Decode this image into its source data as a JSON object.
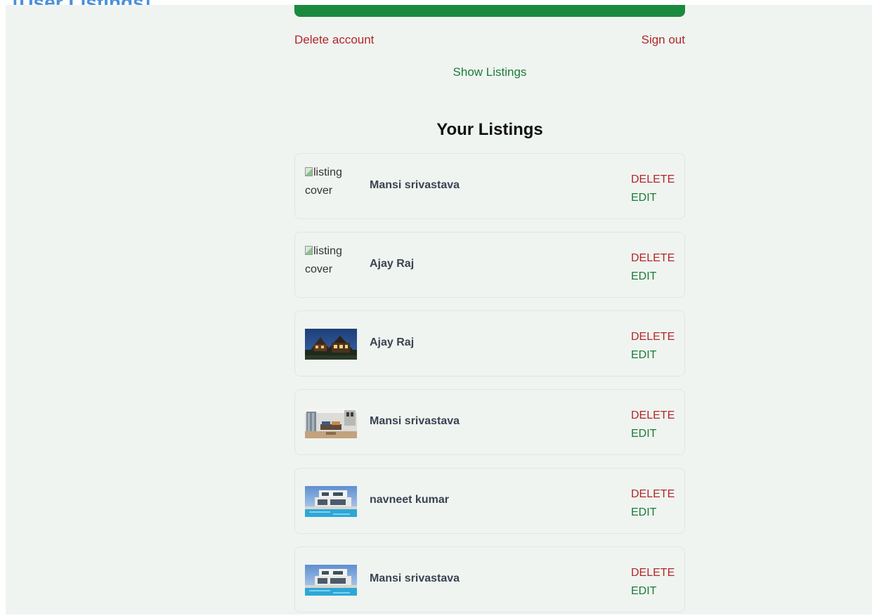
{
  "page_caption": "[User Listings]",
  "account": {
    "delete_account": "Delete account",
    "sign_out": "Sign out",
    "primary_color": "#1a8a3e",
    "danger_color": "#b3262a"
  },
  "show_listings": "Show Listings",
  "listings_title": "Your Listings",
  "actions": {
    "delete": "DELETE",
    "edit": "EDIT"
  },
  "listings": [
    {
      "name": "Mansi srivastava",
      "image": "broken",
      "image_alt": "listing cover"
    },
    {
      "name": "Ajay Raj",
      "image": "broken",
      "image_alt": "listing cover"
    },
    {
      "name": "Ajay Raj",
      "image": "night-house-photo"
    },
    {
      "name": "Mansi srivastava",
      "image": "living-room-photo"
    },
    {
      "name": "navneet kumar",
      "image": "pool-villa-photo"
    },
    {
      "name": "Mansi srivastava",
      "image": "pool-villa-photo"
    }
  ]
}
